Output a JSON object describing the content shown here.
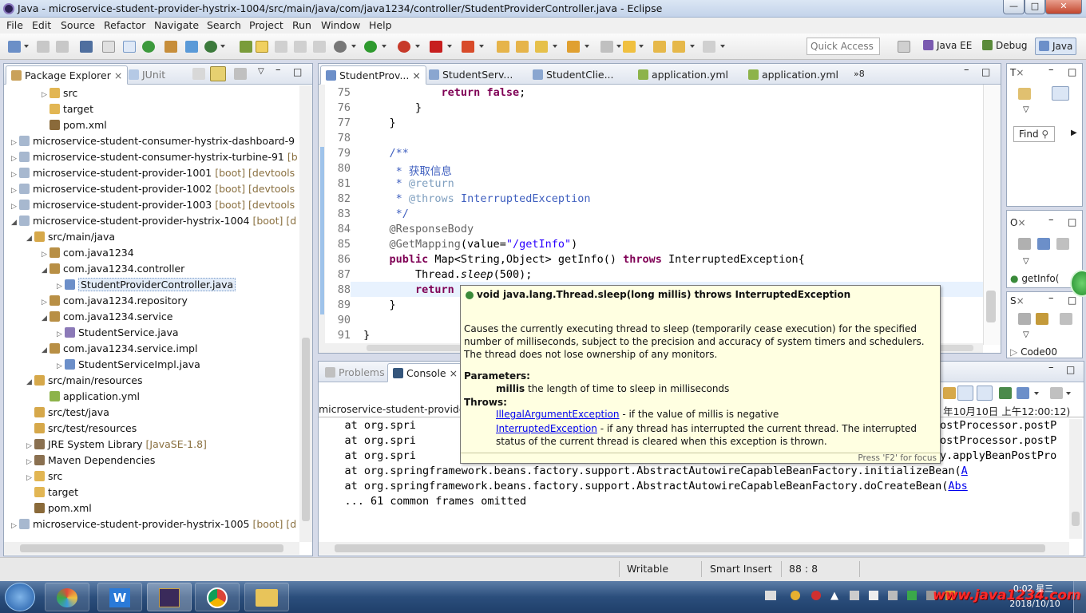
{
  "window": {
    "title": "Java - microservice-student-provider-hystrix-1004/src/main/java/com/java1234/controller/StudentProviderController.java - Eclipse"
  },
  "menu": [
    "File",
    "Edit",
    "Source",
    "Refactor",
    "Navigate",
    "Search",
    "Project",
    "Run",
    "Window",
    "Help"
  ],
  "toolbar": {
    "quick_access": "Quick Access",
    "perspectives": [
      "Java EE",
      "Debug",
      "Java"
    ]
  },
  "explorer": {
    "tabs": [
      "Package Explorer",
      "JUnit"
    ],
    "rows": [
      {
        "label": "src",
        "deco": "",
        "indent": 3,
        "twisty": "▷",
        "icon": "folder"
      },
      {
        "label": "target",
        "deco": "",
        "indent": 3,
        "twisty": "",
        "icon": "folder"
      },
      {
        "label": "pom.xml",
        "deco": "",
        "indent": 3,
        "twisty": "",
        "icon": "xml"
      },
      {
        "label": "microservice-student-consumer-hystrix-dashboard-9",
        "deco": "",
        "indent": 1,
        "twisty": "▷",
        "icon": "project"
      },
      {
        "label": "microservice-student-consumer-hystrix-turbine-91",
        "deco": " [b",
        "indent": 1,
        "twisty": "▷",
        "icon": "project"
      },
      {
        "label": "microservice-student-provider-1001",
        "deco": " [boot] [devtools",
        "indent": 1,
        "twisty": "▷",
        "icon": "project"
      },
      {
        "label": "microservice-student-provider-1002",
        "deco": " [boot] [devtools",
        "indent": 1,
        "twisty": "▷",
        "icon": "project"
      },
      {
        "label": "microservice-student-provider-1003",
        "deco": " [boot] [devtools",
        "indent": 1,
        "twisty": "▷",
        "icon": "project"
      },
      {
        "label": "microservice-student-provider-hystrix-1004",
        "deco": " [boot] [d",
        "indent": 1,
        "twisty": "◢",
        "icon": "project"
      },
      {
        "label": "src/main/java",
        "deco": "",
        "indent": 2,
        "twisty": "◢",
        "icon": "srcfolder"
      },
      {
        "label": "com.java1234",
        "deco": "",
        "indent": 3,
        "twisty": "▷",
        "icon": "package"
      },
      {
        "label": "com.java1234.controller",
        "deco": "",
        "indent": 3,
        "twisty": "◢",
        "icon": "package"
      },
      {
        "label": "StudentProviderController.java",
        "deco": "",
        "indent": 4,
        "twisty": "▷",
        "icon": "java",
        "selected": true
      },
      {
        "label": "com.java1234.repository",
        "deco": "",
        "indent": 3,
        "twisty": "▷",
        "icon": "package"
      },
      {
        "label": "com.java1234.service",
        "deco": "",
        "indent": 3,
        "twisty": "◢",
        "icon": "package"
      },
      {
        "label": "StudentService.java",
        "deco": "",
        "indent": 4,
        "twisty": "▷",
        "icon": "javai"
      },
      {
        "label": "com.java1234.service.impl",
        "deco": "",
        "indent": 3,
        "twisty": "◢",
        "icon": "package"
      },
      {
        "label": "StudentServiceImpl.java",
        "deco": "",
        "indent": 4,
        "twisty": "▷",
        "icon": "java"
      },
      {
        "label": "src/main/resources",
        "deco": "",
        "indent": 2,
        "twisty": "◢",
        "icon": "srcfolder"
      },
      {
        "label": "application.yml",
        "deco": "",
        "indent": 3,
        "twisty": "",
        "icon": "yml"
      },
      {
        "label": "src/test/java",
        "deco": "",
        "indent": 2,
        "twisty": "",
        "icon": "srcfolder"
      },
      {
        "label": "src/test/resources",
        "deco": "",
        "indent": 2,
        "twisty": "",
        "icon": "srcfolder"
      },
      {
        "label": "JRE System Library",
        "deco": " [JavaSE-1.8]",
        "indent": 2,
        "twisty": "▷",
        "icon": "lib"
      },
      {
        "label": "Maven Dependencies",
        "deco": "",
        "indent": 2,
        "twisty": "▷",
        "icon": "lib"
      },
      {
        "label": "src",
        "deco": "",
        "indent": 2,
        "twisty": "▷",
        "icon": "folder"
      },
      {
        "label": "target",
        "deco": "",
        "indent": 2,
        "twisty": "",
        "icon": "folder"
      },
      {
        "label": "pom.xml",
        "deco": "",
        "indent": 2,
        "twisty": "",
        "icon": "xml"
      },
      {
        "label": "microservice-student-provider-hystrix-1005",
        "deco": " [boot] [d",
        "indent": 1,
        "twisty": "▷",
        "icon": "project"
      }
    ]
  },
  "editor": {
    "tabs": [
      "StudentProv...",
      "StudentServ...",
      "StudentClie...",
      "application.yml",
      "application.yml"
    ],
    "overflow": "»8",
    "lines": [
      {
        "n": "75",
        "t": "            return false;"
      },
      {
        "n": "76",
        "t": "        }"
      },
      {
        "n": "77",
        "t": "    }"
      },
      {
        "n": "78",
        "t": ""
      },
      {
        "n": "79",
        "t": "    /**"
      },
      {
        "n": "80",
        "t": "     * 获取信息"
      },
      {
        "n": "81",
        "t": "     * @return"
      },
      {
        "n": "82",
        "t": "     * @throws InterruptedException"
      },
      {
        "n": "83",
        "t": "     */"
      },
      {
        "n": "84",
        "t": "    @ResponseBody"
      },
      {
        "n": "85",
        "t": "    @GetMapping(value=\"/getInfo\")"
      },
      {
        "n": "86",
        "t": "    public Map<String,Object> getInfo() throws InterruptedException{"
      },
      {
        "n": "87",
        "t": "        Thread.sleep(500);"
      },
      {
        "n": "88",
        "t": "        return"
      },
      {
        "n": "89",
        "t": "    }"
      },
      {
        "n": "90",
        "t": ""
      },
      {
        "n": "91",
        "t": "}"
      }
    ]
  },
  "tooltip": {
    "signature": "void java.lang.Thread.sleep(long millis) throws InterruptedException",
    "description": "Causes the currently executing thread to sleep (temporarily cease execution) for the specified number of milliseconds, subject to the precision and accuracy of system timers and schedulers. The thread does not lose ownership of any monitors.",
    "params_label": "Parameters:",
    "param_name": "millis",
    "param_desc": "the length of time to sleep in milliseconds",
    "throws_label": "Throws:",
    "ex1": "IllegalArgumentException",
    "ex1_desc": " - if the value of millis is negative",
    "ex2": "InterruptedException",
    "ex2_desc": " - if any thread has interrupted the current thread. The interrupted status of the current thread is cleared when this exception is thrown.",
    "focus_hint": "Press 'F2' for focus"
  },
  "console": {
    "tabs": [
      "Problems",
      "Console"
    ],
    "header": "microservice-student-provider",
    "header_right": "年10月10日 上午12:00:12)",
    "lines": [
      {
        "left": "    at org.spri",
        "right": "ostProcessor.postP"
      },
      {
        "left": "    at org.spri",
        "right": "ostProcessor.postP"
      },
      {
        "left": "    at org.spri",
        "right": "y.applyBeanPostPro"
      },
      {
        "left": "    at org.springframework.beans.factory.support.AbstractAutowireCapableBeanFactory.initializeBean(",
        "link": "A"
      },
      {
        "left": "    at org.springframework.beans.factory.support.AbstractAutowireCapableBeanFactory.doCreateBean(",
        "link": "Abs"
      },
      {
        "left": "    ... 61 common frames omitted"
      }
    ]
  },
  "right_panels": {
    "find_label": "Find",
    "outline_item": "getInfo(",
    "code_item": "Code00"
  },
  "status": {
    "writable": "Writable",
    "insert": "Smart Insert",
    "position": "88 : 8"
  },
  "taskbar": {
    "time": "0:02 星三",
    "date": "2018/10/10",
    "watermark": "www.java1234.com"
  },
  "colors": {
    "keyword": "#7f0055",
    "comment": "#3f5fbf",
    "string": "#2a00ff",
    "tooltip_bg": "#ffffe1",
    "selection": "#cde8ff"
  }
}
